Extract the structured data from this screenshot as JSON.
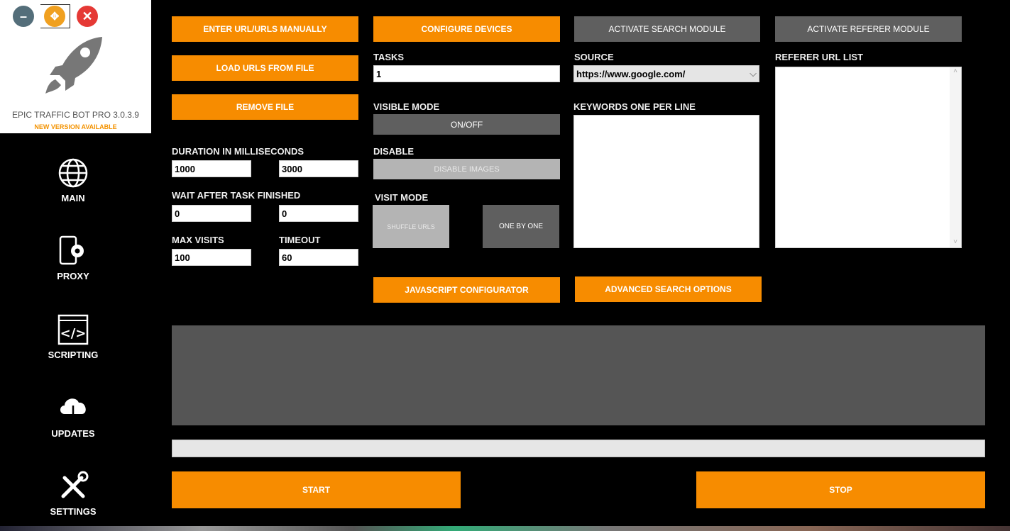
{
  "app": {
    "title": "EPIC TRAFFIC BOT PRO  3.0.3.9",
    "subtitle": "NEW VERSION AVAILABLE"
  },
  "sidebar": {
    "items": [
      {
        "label": "MAIN"
      },
      {
        "label": "PROXY"
      },
      {
        "label": "SCRIPTING"
      },
      {
        "label": "UPDATES"
      },
      {
        "label": "SETTINGS"
      }
    ]
  },
  "buttons": {
    "enter_urls": "ENTER URL/URLS MANUALLY",
    "load_urls": "LOAD URLS FROM FILE",
    "remove_file": "REMOVE FILE",
    "configure_devices": "CONFIGURE DEVICES",
    "activate_search": "ACTIVATE SEARCH MODULE",
    "activate_referer": "ACTIVATE REFERER MODULE",
    "on_off": "ON/OFF",
    "disable_images": "DISABLE IMAGES",
    "shuffle_urls": "SHUFFLE URLS",
    "one_by_one": "ONE BY ONE",
    "js_configurator": "JAVASCRIPT CONFIGURATOR",
    "advanced_search": "ADVANCED SEARCH OPTIONS",
    "start": "START",
    "stop": "STOP"
  },
  "labels": {
    "tasks": "TASKS",
    "visible_mode": "VISIBLE MODE",
    "disable": "DISABLE",
    "visit_mode": "VISIT MODE",
    "source": "SOURCE",
    "keywords": "KEYWORDS ONE PER LINE",
    "referer_list": "REFERER URL LIST",
    "duration": "DURATION IN MILLISECONDS",
    "wait": "WAIT AFTER TASK FINISHED",
    "max_visits": "MAX VISITS",
    "timeout": "TIMEOUT"
  },
  "fields": {
    "tasks": "1",
    "source": "https://www.google.com/",
    "duration_min": "1000",
    "duration_max": "3000",
    "wait_min": "0",
    "wait_max": "0",
    "max_visits": "100",
    "timeout": "60"
  }
}
